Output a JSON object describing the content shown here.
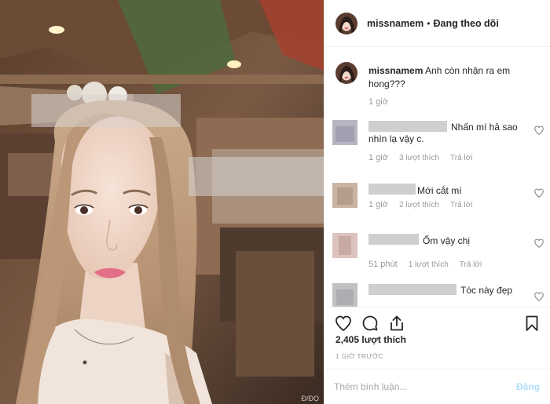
{
  "post": {
    "image_caption": "Đ/ĐỌ"
  },
  "header": {
    "username": "missnamem",
    "separator": "•",
    "follow_status": "Đang theo dõi"
  },
  "caption": {
    "username": "missnamem",
    "text": "Anh còn nhận ra em hong???",
    "time": "1 giờ"
  },
  "comments": [
    {
      "text": "Nhấn mí hả sao nhìn lạ vậy c.",
      "time": "1 giờ",
      "likes": "3 lượt thích",
      "reply": "Trả lời"
    },
    {
      "text": "Mới cắt mí",
      "time": "1 giờ",
      "likes": "2 lượt thích",
      "reply": "Trả lời"
    },
    {
      "text": "Ốm vậy chị",
      "time": "51 phút",
      "likes": "1 lượt thích",
      "reply": "Trả lời"
    },
    {
      "text": "Tóc này đẹp",
      "time": "",
      "likes": "",
      "reply": ""
    }
  ],
  "actions": {
    "like_icon": "heart-icon",
    "comment_icon": "comment-icon",
    "share_icon": "share-icon",
    "save_icon": "bookmark-icon"
  },
  "stats": {
    "likes": "2,405 lượt thích",
    "time_ago": "1 GIỜ TRƯỚC"
  },
  "add_comment": {
    "placeholder": "Thêm bình luận...",
    "post_label": "Đăng"
  },
  "colors": {
    "text": "#262626",
    "muted": "#999999",
    "post_disabled": "#b2dffc",
    "border": "#efefef"
  }
}
